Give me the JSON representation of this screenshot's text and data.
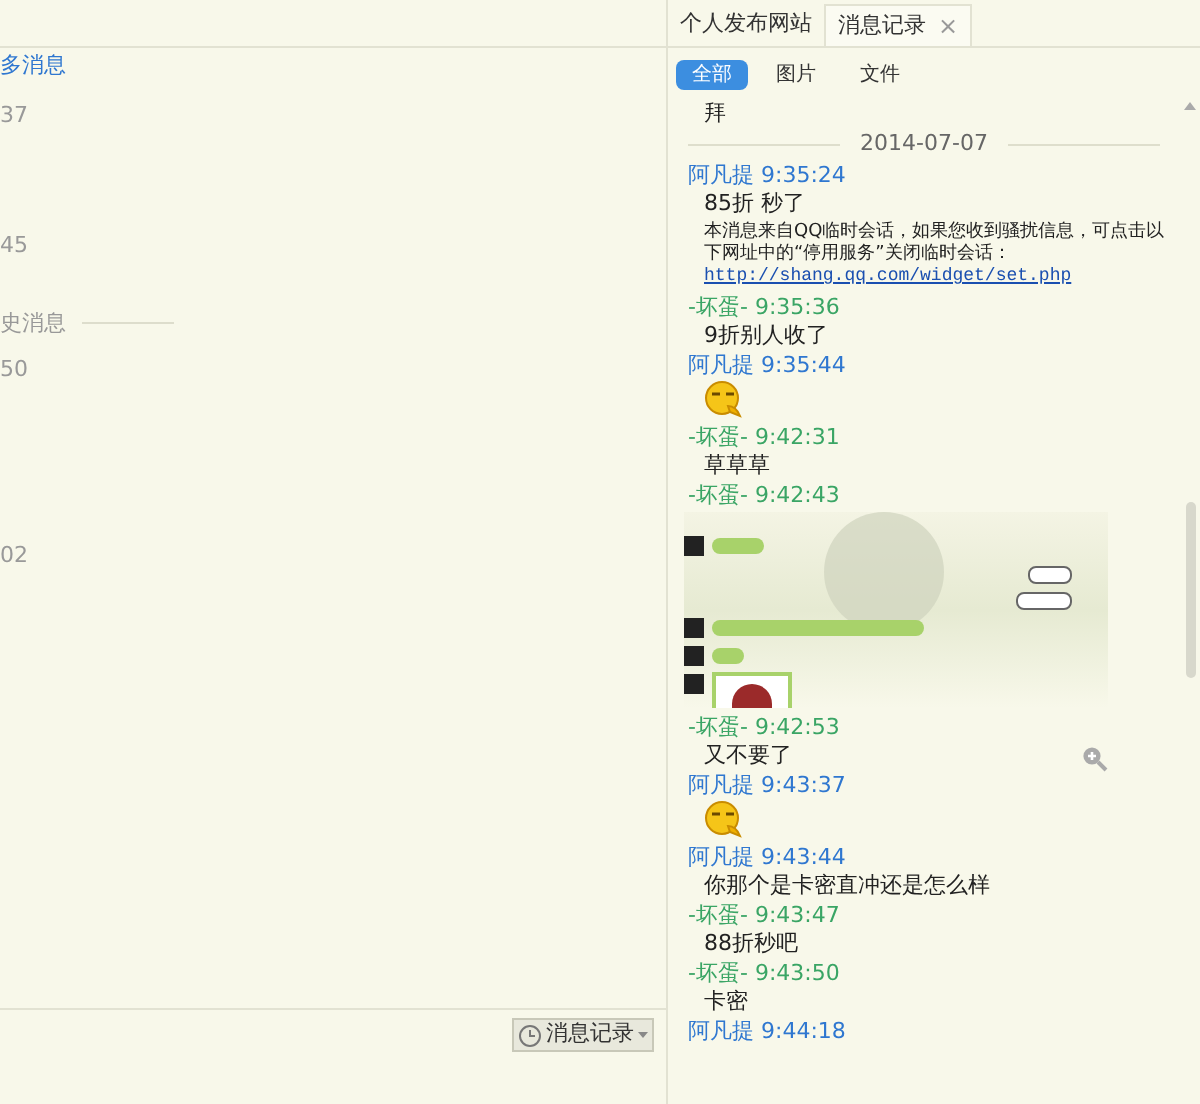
{
  "left": {
    "items": [
      {
        "kind": "link",
        "text": "多消息"
      },
      {
        "kind": "time",
        "text": "37"
      },
      {
        "kind": "time",
        "text": "45"
      },
      {
        "kind": "divider",
        "text": "史消息"
      },
      {
        "kind": "time",
        "text": "50"
      },
      {
        "kind": "time",
        "text": "02"
      }
    ],
    "history_button": "消息记录"
  },
  "tabs": [
    {
      "label": "个人发布网站",
      "selected": false,
      "closable": false
    },
    {
      "label": "消息记录",
      "selected": true,
      "closable": true
    }
  ],
  "close_glyph": "×",
  "filters": [
    {
      "label": "全部",
      "selected": true
    },
    {
      "label": "图片",
      "selected": false
    },
    {
      "label": "文件",
      "selected": false
    }
  ],
  "messages": [
    {
      "kind": "text",
      "text": "拜"
    },
    {
      "kind": "date",
      "text": "2014-07-07"
    },
    {
      "kind": "sender",
      "name": "阿凡提",
      "time": "9:35:24",
      "color": "#2f77d0"
    },
    {
      "kind": "text",
      "text": "85折 秒了"
    },
    {
      "kind": "notice",
      "text": "本消息来自QQ临时会话，如果您收到骚扰信息，可点击以下网址中的“停用服务”关闭临时会话：",
      "link": "http://shang.qq.com/widget/set.php"
    },
    {
      "kind": "sender",
      "name": "-坏蛋-",
      "time": "9:35:36",
      "color": "#3aa565"
    },
    {
      "kind": "text",
      "text": "9折别人收了"
    },
    {
      "kind": "sender",
      "name": "阿凡提",
      "time": "9:35:44",
      "color": "#2f77d0"
    },
    {
      "kind": "emoji"
    },
    {
      "kind": "sender",
      "name": "-坏蛋-",
      "time": "9:42:31",
      "color": "#3aa565"
    },
    {
      "kind": "text",
      "text": "草草草"
    },
    {
      "kind": "sender",
      "name": "-坏蛋-",
      "time": "9:42:43",
      "color": "#3aa565"
    },
    {
      "kind": "image"
    },
    {
      "kind": "sender",
      "name": "-坏蛋-",
      "time": "9:42:53",
      "color": "#3aa565"
    },
    {
      "kind": "text",
      "text": "又不要了"
    },
    {
      "kind": "sender",
      "name": "阿凡提",
      "time": "9:43:37",
      "color": "#2f77d0"
    },
    {
      "kind": "emoji"
    },
    {
      "kind": "sender",
      "name": "阿凡提",
      "time": "9:43:44",
      "color": "#2f77d0"
    },
    {
      "kind": "text",
      "text": "你那个是卡密直冲还是怎么样"
    },
    {
      "kind": "sender",
      "name": "-坏蛋-",
      "time": "9:43:47",
      "color": "#3aa565"
    },
    {
      "kind": "text",
      "text": "88折秒吧"
    },
    {
      "kind": "sender",
      "name": "-坏蛋-",
      "time": "9:43:50",
      "color": "#3aa565"
    },
    {
      "kind": "text",
      "text": "卡密"
    },
    {
      "kind": "sender",
      "name": "阿凡提",
      "time": "9:44:18",
      "color": "#2f77d0"
    }
  ]
}
